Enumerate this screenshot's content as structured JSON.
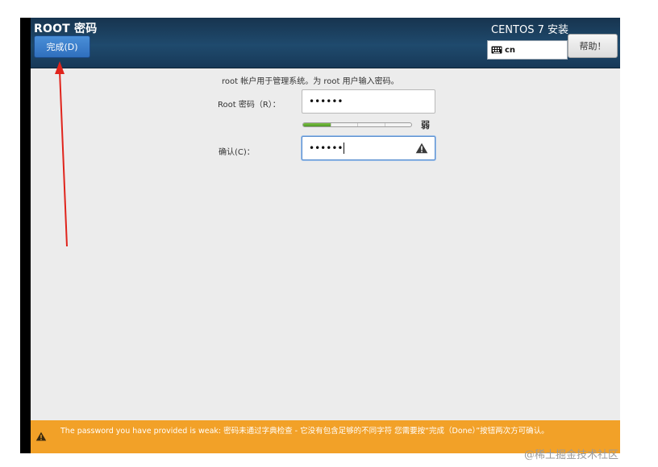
{
  "header": {
    "spoke_title": "ROOT 密码",
    "done_label": "完成(D)",
    "product_title": "CENTOS 7 安装",
    "keyboard_layout": "cn",
    "help_label": "帮助！"
  },
  "form": {
    "intro": "root 帐户用于管理系统。为 root 用户输入密码。",
    "password_label": "Root 密码（R）：",
    "password_value": "••••••",
    "confirm_label": "确认(C)：",
    "confirm_value": "••••••",
    "strength": {
      "level_fraction": 0.25,
      "label": "弱"
    }
  },
  "warning": {
    "message": "The password you have provided is weak: 密码未通过字典检查 - 它没有包含足够的不同字符 您需要按“完成（Done）”按钮两次方可确认。"
  },
  "watermark": "@稀土掘金技术社区",
  "colors": {
    "header_bg": "#1f4a6d",
    "done_button": "#3a7fd0",
    "warning_bar": "#f2a128",
    "strength_fill": "#5fa832",
    "annotation_arrow": "#e0241c"
  }
}
